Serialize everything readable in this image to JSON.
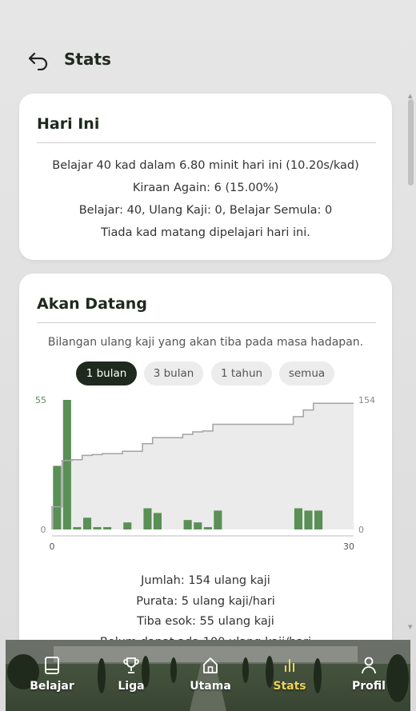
{
  "header": {
    "title": "Stats"
  },
  "today": {
    "title": "Hari Ini",
    "lines": [
      "Belajar 40 kad dalam 6.80 minit hari ini (10.20s/kad)",
      "Kiraan Again: 6 (15.00%)",
      "Belajar: 40, Ulang Kaji: 0, Belajar Semula: 0",
      "Tiada kad matang dipelajari hari ini."
    ]
  },
  "upcoming": {
    "title": "Akan Datang",
    "description": "Bilangan ulang kaji yang akan tiba pada masa hadapan.",
    "ranges": [
      "1 bulan",
      "3 bulan",
      "1 tahun",
      "semua"
    ],
    "selected_range": "1 bulan",
    "summary": [
      "Jumlah: 154 ulang kaji",
      "Purata: 5 ulang kaji/hari",
      "Tiba esok: 55 ulang kaji",
      "Belum dapat ada 100 ulang kaji/hari"
    ]
  },
  "chart_data": {
    "type": "bar",
    "x": [
      0,
      1,
      2,
      3,
      4,
      5,
      7,
      9,
      10,
      13,
      14,
      15,
      16,
      24,
      25,
      26
    ],
    "values": [
      27,
      55,
      1,
      5,
      1,
      1,
      3,
      9,
      7,
      4,
      3,
      1,
      8,
      9,
      8,
      8
    ],
    "cumulative": [
      27,
      82,
      83,
      88,
      89,
      90,
      93,
      102,
      109,
      113,
      116,
      117,
      125,
      134,
      142,
      150
    ],
    "ylim_left": [
      0,
      55
    ],
    "ylim_right": [
      0,
      154
    ],
    "xlim": [
      0,
      30
    ],
    "left_ticks": [
      "0",
      "55"
    ],
    "right_ticks": [
      "0",
      "154"
    ],
    "x_ticks": [
      "0",
      "30"
    ],
    "bar_color": "#5a8f55",
    "line_color": "#a3a3a3",
    "area_color": "#ebebeb"
  },
  "nav": {
    "items": [
      {
        "label": "Belajar",
        "icon": "book-icon"
      },
      {
        "label": "Liga",
        "icon": "trophy-icon"
      },
      {
        "label": "Utama",
        "icon": "home-icon"
      },
      {
        "label": "Stats",
        "icon": "bar-chart-icon"
      },
      {
        "label": "Profil",
        "icon": "user-icon"
      }
    ],
    "active": "Stats",
    "active_color": "#f1d35a"
  }
}
